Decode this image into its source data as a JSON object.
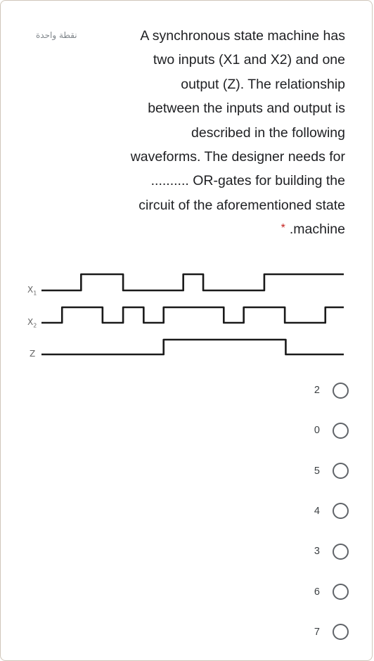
{
  "question": {
    "points_label": "نقطة واحدة",
    "lines": [
      "A synchronous state machine has",
      "two inputs (X1 and X2) and one",
      "output (Z). The relationship",
      "between the inputs and output is",
      "described in the following",
      "waveforms. The designer needs for",
      ".......... OR-gates for building the",
      "circuit of the aforementioned state",
      ".machine"
    ],
    "required_marker": "*",
    "required_color": "#c5221f"
  },
  "waveform_diagram": {
    "signals": [
      {
        "name": "X",
        "subscript": "1",
        "levels": [
          0,
          1,
          1,
          0,
          0,
          0,
          1,
          0,
          0,
          1,
          1,
          1
        ],
        "transitions": [
          {
            "t": 0.0,
            "level": 0
          },
          {
            "t": 0.131,
            "level": 1
          },
          {
            "t": 0.27,
            "level": 0
          },
          {
            "t": 0.469,
            "level": 1
          },
          {
            "t": 0.535,
            "level": 0
          },
          {
            "t": 0.737,
            "level": 1
          },
          {
            "t": 1.0,
            "level": 1
          }
        ]
      },
      {
        "name": "X",
        "subscript": "2",
        "transitions": [
          {
            "t": 0.0,
            "level": 0
          },
          {
            "t": 0.068,
            "level": 1
          },
          {
            "t": 0.202,
            "level": 0
          },
          {
            "t": 0.27,
            "level": 1
          },
          {
            "t": 0.338,
            "level": 0
          },
          {
            "t": 0.404,
            "level": 1
          },
          {
            "t": 0.603,
            "level": 0
          },
          {
            "t": 0.669,
            "level": 1
          },
          {
            "t": 0.805,
            "level": 0
          },
          {
            "t": 0.939,
            "level": 1
          },
          {
            "t": 1.0,
            "level": 1
          }
        ]
      },
      {
        "name": "Z",
        "subscript": "",
        "transitions": [
          {
            "t": 0.0,
            "level": 0
          },
          {
            "t": 0.404,
            "level": 1
          },
          {
            "t": 0.808,
            "level": 0
          },
          {
            "t": 1.0,
            "level": 0
          }
        ]
      }
    ]
  },
  "options": [
    {
      "label": "2",
      "selected": false
    },
    {
      "label": "0",
      "selected": false
    },
    {
      "label": "5",
      "selected": false
    },
    {
      "label": "4",
      "selected": false
    },
    {
      "label": "3",
      "selected": false
    },
    {
      "label": "6",
      "selected": false
    },
    {
      "label": "7",
      "selected": false
    }
  ]
}
